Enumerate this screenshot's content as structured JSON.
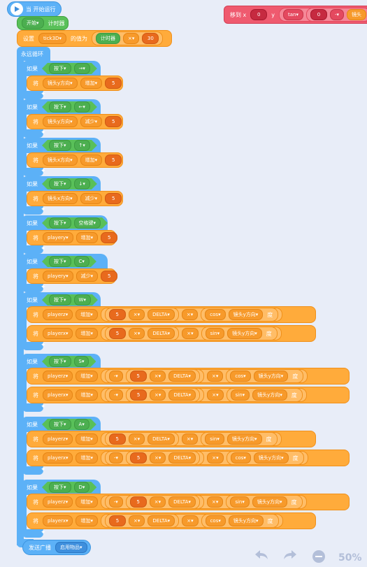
{
  "hat": {
    "label": "当 开始运行"
  },
  "timer_start": {
    "verb": "开始",
    "target": "计时器"
  },
  "set_var": {
    "verb": "设置",
    "var": "tick3D",
    "mid": "的值为",
    "reporter": "计时器",
    "op": "×",
    "value": "30"
  },
  "forever": {
    "label": "永远循环"
  },
  "if_label": "如果",
  "key_pressed": "按下",
  "say_will": "将",
  "if_blocks": [
    {
      "key": "→",
      "target": "镜头y方向",
      "op": "增加",
      "value": "5"
    },
    {
      "key": "←",
      "target": "镜头y方向",
      "op": "减少",
      "value": "5"
    },
    {
      "key": "↑",
      "target": "镜头x方向",
      "op": "增加",
      "value": "5"
    },
    {
      "key": "↓",
      "target": "镜头x方向",
      "op": "减少",
      "value": "5"
    },
    {
      "key": "空格键",
      "target": "playery",
      "op": "增加",
      "value": "5"
    },
    {
      "key": "C",
      "target": "playery",
      "op": "减少",
      "value": "5"
    }
  ],
  "move_blocks": {
    "W": {
      "key": "W",
      "r1": {
        "var": "playerz",
        "op": "增加",
        "num": "5",
        "m1": "×",
        "delta": "DELTA",
        "m2": "×",
        "fn": "cos",
        "ang": "镜头y方向",
        "unit": "度"
      },
      "r2": {
        "var": "playerx",
        "op": "增加",
        "num": "5",
        "m1": "×",
        "delta": "DELTA",
        "m2": "×",
        "fn": "sin",
        "ang": "镜头y方向",
        "unit": "度"
      }
    },
    "S": {
      "key": "S",
      "r1": {
        "var": "playerz",
        "op": "增加",
        "neg": "-",
        "num": "5",
        "m1": "×",
        "delta": "DELTA",
        "m2": "×",
        "fn": "cos",
        "ang": "镜头y方向",
        "unit": "度"
      },
      "r2": {
        "var": "playerx",
        "op": "增加",
        "neg": "-",
        "num": "5",
        "m1": "×",
        "delta": "DELTA",
        "m2": "×",
        "fn": "sin",
        "ang": "镜头y方向",
        "unit": "度"
      }
    },
    "A": {
      "key": "A",
      "r1": {
        "var": "playerz",
        "op": "增加",
        "num": "5",
        "m1": "×",
        "delta": "DELTA",
        "m2": "×",
        "fn": "sin",
        "ang": "镜头y方向",
        "unit": "度"
      },
      "r2": {
        "var": "playerx",
        "op": "增加",
        "neg": "-",
        "num": "5",
        "m1": "×",
        "delta": "DELTA",
        "m2": "×",
        "fn": "cos",
        "ang": "镜头y方向",
        "unit": "度"
      }
    },
    "D": {
      "key": "D",
      "r1": {
        "var": "playerz",
        "op": "增加",
        "neg": "-",
        "num": "5",
        "m1": "×",
        "delta": "DELTA",
        "m2": "×",
        "fn": "sin",
        "ang": "镜头y方向",
        "unit": "度"
      },
      "r2": {
        "var": "playerx",
        "op": "增加",
        "num": "5",
        "m1": "×",
        "delta": "DELTA",
        "m2": "×",
        "fn": "cos",
        "ang": "镜头y方向",
        "unit": "度"
      }
    }
  },
  "broadcast": {
    "label": "发送广播",
    "msg": "启用物品"
  },
  "detached": {
    "label": "移到 x",
    "x": "0",
    "ylabel": "y",
    "fn": "tan",
    "num": "0",
    "op": "-",
    "trail": "镜头"
  },
  "zoom": {
    "label": "50%"
  },
  "colors": {
    "control": "#5cb1f7",
    "variable": "#ffab3b",
    "operator": "#59c059",
    "motion": "#ef5a6f"
  }
}
